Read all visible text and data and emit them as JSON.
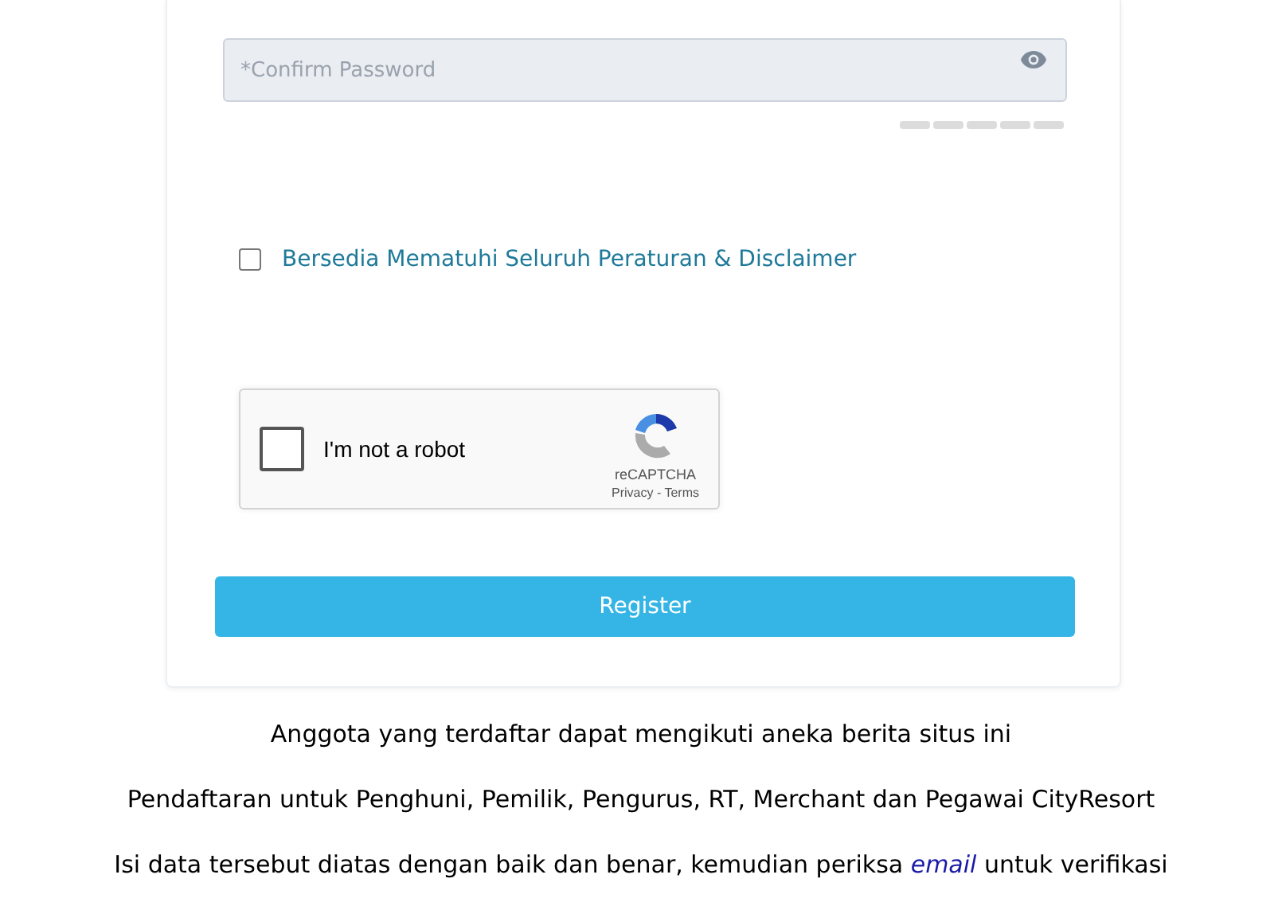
{
  "confirm_password": {
    "placeholder": "*Confirm Password"
  },
  "agreement": {
    "label": "Bersedia Mematuhi Seluruh Peraturan & Disclaimer",
    "checked": false
  },
  "captcha": {
    "label": "I'm not a robot",
    "checked": false,
    "brand": "reCAPTCHA",
    "privacy": "Privacy",
    "separator": " - ",
    "terms": "Terms"
  },
  "register_button": "Register",
  "notes": [
    {
      "text": "Anggota yang terdaftar dapat mengikuti aneka berita situs ini"
    },
    {
      "text": "Pendaftaran untuk Penghuni, Pemilik, Pengurus, RT, Merchant dan Pegawai CityResort"
    },
    {
      "text": "Isi data tersebut diatas dengan baik dan benar, kemudian periksa ",
      "link": "email",
      "after": " untuk verifikasi"
    }
  ]
}
